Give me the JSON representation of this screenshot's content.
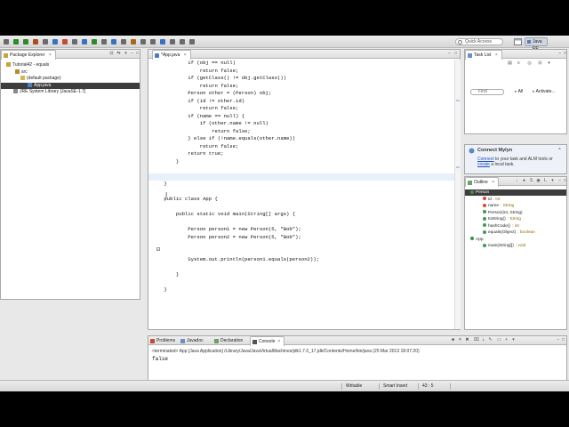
{
  "toolbar": {
    "quick_access_placeholder": "Quick Access",
    "perspective_label": "Java EE",
    "icon_colors": [
      "#6a6a6a",
      "#2c8a2c",
      "#2c8a2c",
      "#b04a1a",
      "#6a6a6a",
      "#3a6fc4",
      "#c44a3a",
      "#6a6a6a",
      "#3a6fc4",
      "#2c8a2c",
      "#6a6a6a",
      "#3a6fc4",
      "#6a6a6a",
      "#a36b1f",
      "#6a6a6a",
      "#6a6a6a",
      "#3a6fc4",
      "#6a6a6a",
      "#6a6a6a",
      "#6a6a6a"
    ]
  },
  "package_explorer": {
    "tab_label": "Package Explorer",
    "tree": [
      {
        "label": "Tutorial42 - equals",
        "icon": "project-icon",
        "selected": false
      },
      {
        "label": "src",
        "icon": "source-folder-icon",
        "selected": false
      },
      {
        "label": "(default package)",
        "icon": "package-icon",
        "selected": false
      },
      {
        "label": "App.java",
        "icon": "java-file-icon",
        "selected": true
      },
      {
        "label": "JRE System Library [JavaSE-1.7]",
        "icon": "library-icon",
        "selected": false
      }
    ]
  },
  "editor": {
    "tab_label": "*App.java",
    "lines": [
      "            if (obj == null)",
      "                return false;",
      "            if (getClass() != obj.getClass())",
      "                return false;",
      "            Person other = (Person) obj;",
      "            if (id != other.id)",
      "                return false;",
      "            if (name == null) {",
      "                if (other.name != null)",
      "                    return false;",
      "            } else if (!name.equals(other.name))",
      "                return false;",
      "            return true;",
      "        }",
      "",
      "",
      "    }",
      "",
      "    public class App {",
      "",
      "        public static void main(String[] args) {",
      "",
      "            Person person1 = new Person(5, \"Bob\");",
      "            Person person2 = new Person(5, \"Bob\");",
      "",
      "",
      "            System.out.println(person1.equals(person2));",
      "",
      "        }",
      "",
      "    }"
    ]
  },
  "task_list": {
    "tab_label": "Task List",
    "find_placeholder": "Find",
    "all_label": "All",
    "activate_label": "Activate..."
  },
  "mylyn": {
    "title": "Connect Mylyn",
    "link1": "Connect",
    "text1": " to your task and ALM tools or",
    "link2": "create",
    "text2": " a local task."
  },
  "outline": {
    "tab_label": "Outline",
    "items": [
      {
        "label": "Person",
        "type": "",
        "indent": 0,
        "icon": "class-icon"
      },
      {
        "label": "id",
        "type": ": int",
        "indent": 1,
        "icon": "field-icon"
      },
      {
        "label": "name",
        "type": ": String",
        "indent": 1,
        "icon": "field-icon"
      },
      {
        "label": "Person(int, String)",
        "type": "",
        "indent": 1,
        "icon": "constructor-icon"
      },
      {
        "label": "toString()",
        "type": ": String",
        "indent": 1,
        "icon": "method-icon"
      },
      {
        "label": "hashCode()",
        "type": ": int",
        "indent": 1,
        "icon": "method-icon"
      },
      {
        "label": "equals(Object)",
        "type": ": boolean",
        "indent": 1,
        "icon": "method-icon"
      },
      {
        "label": "App",
        "type": "",
        "indent": 0,
        "icon": "class-icon"
      },
      {
        "label": "main(String[])",
        "type": ": void",
        "indent": 1,
        "icon": "static-method-icon"
      }
    ]
  },
  "bottom": {
    "tabs": [
      "Problems",
      "Javadoc",
      "Declaration",
      "Console"
    ],
    "active_tab": "Console",
    "console_desc": "<terminated> App [Java Application] /Library/Java/JavaVirtualMachines/jdk1.7.0_17.jdk/Contents/Home/bin/java (25 Mar 2013 18:07:20)",
    "console_output": "false"
  },
  "status": {
    "writable": "Writable",
    "insert_mode": "Smart Insert",
    "position": "43 : 5"
  }
}
